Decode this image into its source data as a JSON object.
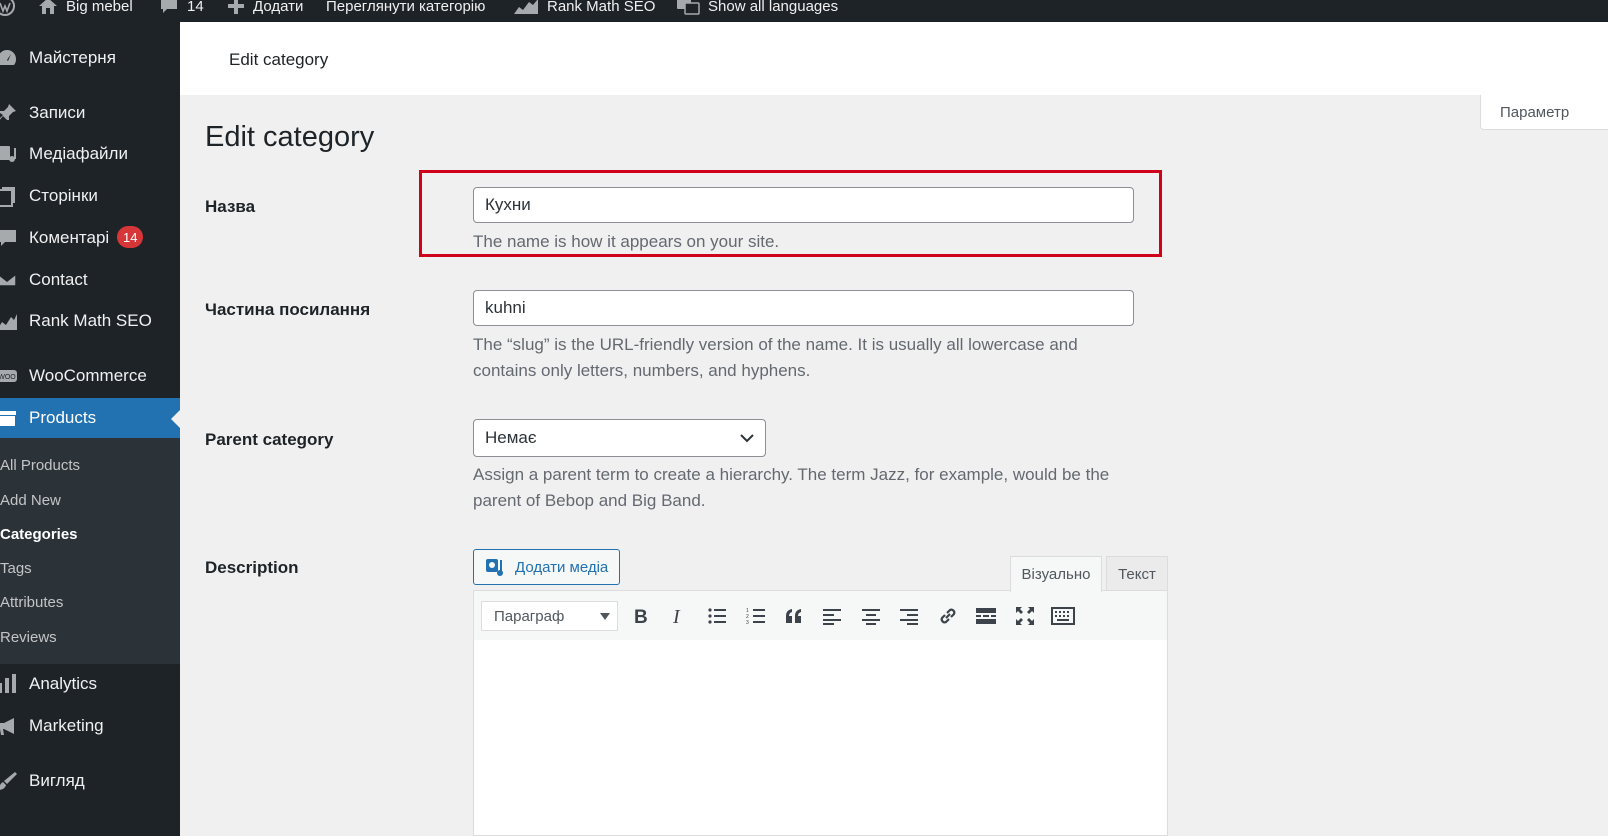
{
  "adminbar": {
    "site_name": "Big mebel",
    "comments_count": "14",
    "new_label": "Додати",
    "view_category": "Переглянути категорію",
    "rank_math": "Rank Math SEO",
    "languages": "Show all languages"
  },
  "sidebar": {
    "items": [
      {
        "label": "Майстерня",
        "icon": "dashboard-icon"
      },
      {
        "label": "Записи",
        "icon": "pin-icon"
      },
      {
        "label": "Медіафайли",
        "icon": "media-icon"
      },
      {
        "label": "Сторінки",
        "icon": "pages-icon"
      },
      {
        "label": "Коментарі",
        "icon": "comments-icon",
        "badge": "14"
      },
      {
        "label": "Contact",
        "icon": "mail-icon"
      },
      {
        "label": "Rank Math SEO",
        "icon": "rank-math-icon"
      },
      {
        "label": "WooCommerce",
        "icon": "woo-icon"
      },
      {
        "label": "Products",
        "icon": "archive-icon"
      },
      {
        "label": "Analytics",
        "icon": "chart-bar-icon"
      },
      {
        "label": "Marketing",
        "icon": "megaphone-icon"
      },
      {
        "label": "Вигляд",
        "icon": "brush-icon"
      }
    ],
    "submenu": [
      "All Products",
      "Add New",
      "Categories",
      "Tags",
      "Attributes",
      "Reviews"
    ]
  },
  "header": {
    "title": "Edit category"
  },
  "screen_options": "Параметр",
  "page_title": "Edit category",
  "form": {
    "name_label": "Назва",
    "name_value": "Кухни",
    "name_desc": "The name is how it appears on your site.",
    "slug_label": "Частина посилання",
    "slug_value": "kuhni",
    "slug_desc": "The “slug” is the URL-friendly version of the name. It is usually all lowercase and contains only letters, numbers, and hyphens.",
    "parent_label": "Parent category",
    "parent_value": "Немає",
    "parent_desc": "Assign a parent term to create a hierarchy. The term Jazz, for example, would be the parent of Bebop and Big Band.",
    "description_label": "Description"
  },
  "editor": {
    "add_media": "Додати медіа",
    "tab_visual": "Візуально",
    "tab_text": "Текст",
    "format_value": "Параграф"
  },
  "colors": {
    "highlight": "#d0021b",
    "accent": "#2271b1",
    "sidebar": "#1d2327"
  }
}
